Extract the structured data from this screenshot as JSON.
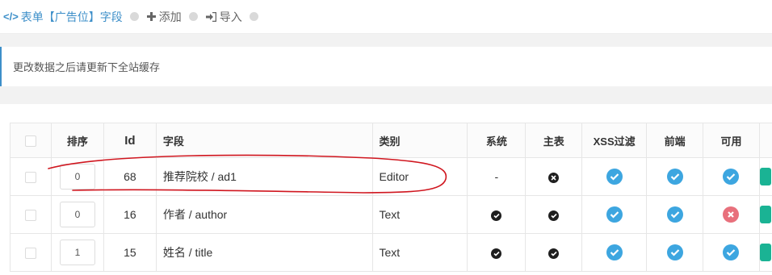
{
  "toolbar": {
    "items": [
      {
        "icon": "code-icon",
        "glyph": "</>",
        "label": "表单【广告位】字段"
      },
      {
        "icon": "plus-icon",
        "label": "添加"
      },
      {
        "icon": "import-icon",
        "label": "导入"
      }
    ]
  },
  "notice": {
    "text": "更改数据之后请更新下全站缓存"
  },
  "table": {
    "headers": [
      "排序",
      "Id",
      "字段",
      "类别",
      "系统",
      "主表",
      "XSS过滤",
      "前端",
      "可用"
    ],
    "rows": [
      {
        "order": "0",
        "id": "68",
        "field": "推荐院校 / ad1",
        "type": "Editor",
        "system": "-",
        "main": "x",
        "xss": true,
        "front": true,
        "enabled": true
      },
      {
        "order": "0",
        "id": "16",
        "field": "作者 / author",
        "type": "Text",
        "system": "check",
        "main": "check",
        "xss": true,
        "front": true,
        "enabled": false
      },
      {
        "order": "1",
        "id": "15",
        "field": "姓名 / title",
        "type": "Text",
        "system": "check",
        "main": "check",
        "xss": true,
        "front": true,
        "enabled": true
      }
    ]
  },
  "colors": {
    "accent": "#3d8fc9",
    "check_blue": "#3da6e0",
    "disabled_red": "#e8707c",
    "annotation_red": "#d0161f",
    "action_green": "#1ab394"
  }
}
